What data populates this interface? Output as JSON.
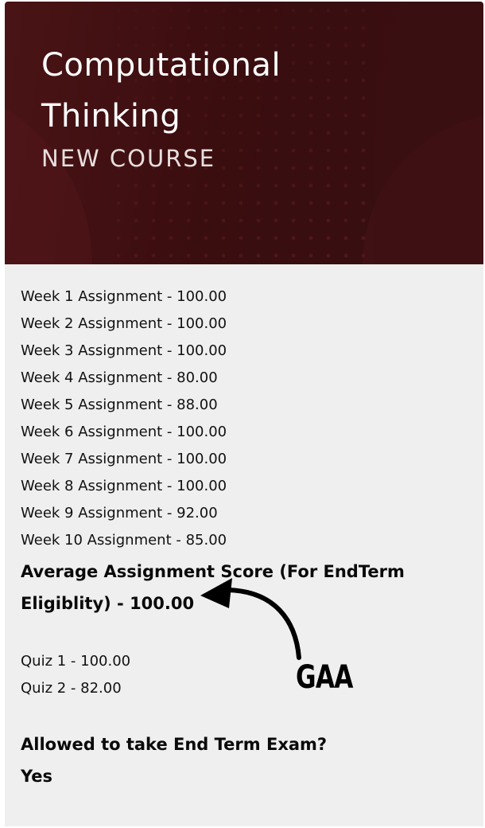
{
  "course": {
    "title_line1": "Computational",
    "title_line2": "Thinking",
    "subtitle": "NEW COURSE"
  },
  "assignments": [
    "Week 1 Assignment - 100.00",
    "Week 2 Assignment - 100.00",
    "Week 3 Assignment - 100.00",
    "Week 4 Assignment - 80.00",
    "Week 5 Assignment - 88.00",
    "Week 6 Assignment - 100.00",
    "Week 7 Assignment - 100.00",
    "Week 8 Assignment - 100.00",
    "Week 9 Assignment - 92.00",
    "Week 10 Assignment - 85.00"
  ],
  "average": {
    "line1": "Average Assignment Score (For EndTerm",
    "line2": "Eligiblity) - 100.00"
  },
  "quizzes": [
    "Quiz 1 - 100.00",
    "Quiz 2 - 82.00"
  ],
  "exam": {
    "question": "Allowed to take End Term Exam?",
    "answer": "Yes"
  },
  "annotation": {
    "label": "GAA"
  },
  "colors": {
    "banner": "#3a0d0f",
    "panel": "#efefef",
    "text": "#111111"
  }
}
